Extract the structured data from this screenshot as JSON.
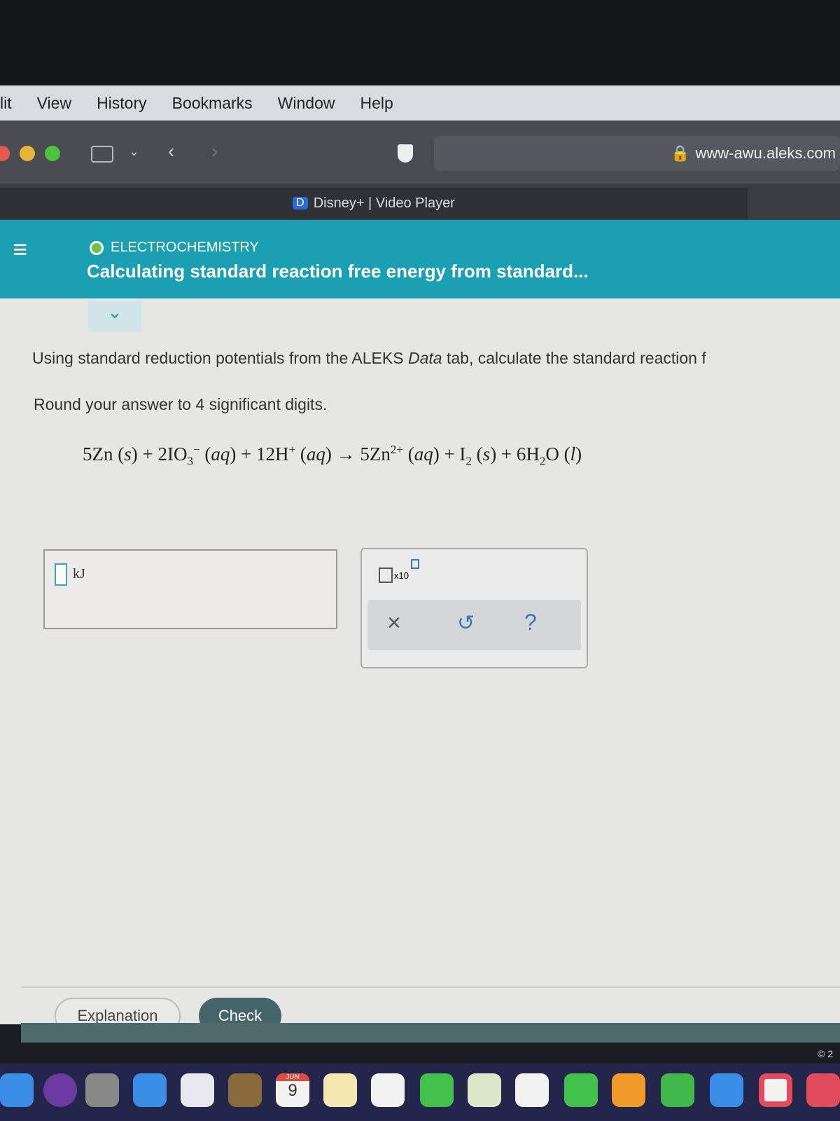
{
  "menu": [
    "lit",
    "View",
    "History",
    "Bookmarks",
    "Window",
    "Help"
  ],
  "browser": {
    "url": "www-awu.aleks.com",
    "tab_title": "Disney+ | Video Player"
  },
  "header": {
    "topic": "ELECTROCHEMISTRY",
    "title": "Calculating standard reaction free energy from standard..."
  },
  "question": {
    "instruction_pre": "Using standard reduction potentials from the ALEKS ",
    "instruction_em": "Data",
    "instruction_post": " tab, calculate the standard reaction f",
    "round": "Round your answer to 4 significant digits."
  },
  "answer": {
    "unit": "kJ",
    "value": ""
  },
  "tools": {
    "sci": "x10",
    "clear": "×",
    "undo": "↺",
    "help": "?"
  },
  "buttons": {
    "explanation": "Explanation",
    "check": "Check"
  },
  "footer": {
    "copyright": "© 2"
  },
  "dock": {
    "calendar_month": "JUN",
    "calendar_day": "9",
    "apps": [
      "finder",
      "siri",
      "launchpad",
      "mail",
      "safari",
      "contacts",
      "calendar",
      "notes",
      "reminders",
      "messages",
      "maps",
      "photos",
      "facetime",
      "pages",
      "numbers",
      "keynote",
      "news",
      "music"
    ]
  }
}
